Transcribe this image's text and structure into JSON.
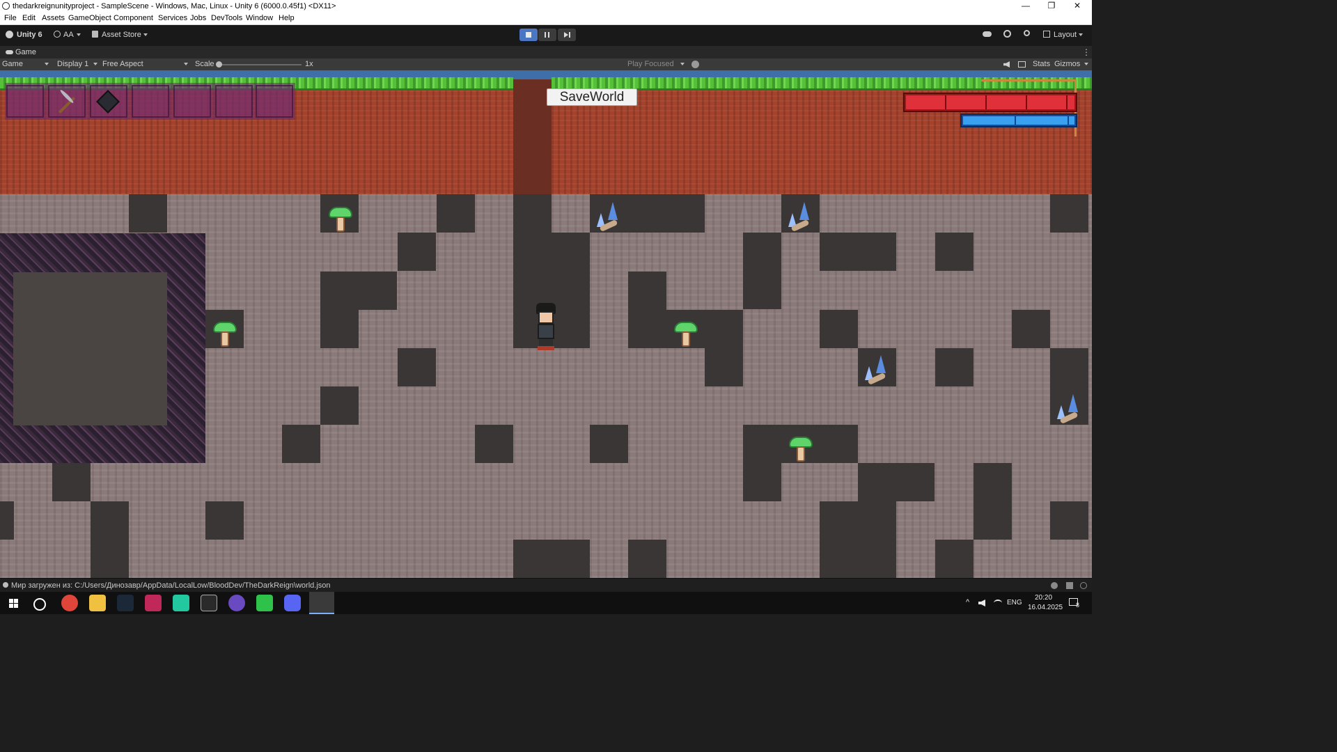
{
  "window": {
    "title": "thedarkreignunityproject - SampleScene - Windows, Mac, Linux - Unity 6 (6000.0.45f1) <DX11>",
    "controls": [
      "—",
      "❐",
      "✕"
    ]
  },
  "menubar": {
    "items": [
      "File",
      "Edit",
      "Assets",
      "GameObject",
      "Component",
      "Services",
      "Jobs",
      "DevTools",
      "Window",
      "Help"
    ]
  },
  "toolbar": {
    "unity_label": "Unity 6",
    "account_label": "AA",
    "asset_store_label": "Asset Store",
    "layout_label": "Layout"
  },
  "tab": {
    "game_label": "Game"
  },
  "game_toolbar": {
    "mode": "Game",
    "display": "Display 1",
    "aspect": "Free Aspect",
    "scale_label": "Scale",
    "scale_value": "1x",
    "scale_level": 0,
    "play_focused": "Play Focused",
    "stats_label": "Stats",
    "gizmos_label": "Gizmos"
  },
  "hud": {
    "save_button": "SaveWorld",
    "health_fraction": 1.0,
    "mana_fraction": 1.0,
    "hotbar_slots": [
      "empty",
      "pickaxe",
      "ore-bag",
      "empty",
      "empty",
      "empty",
      "empty"
    ]
  },
  "status": {
    "message": "Мир загружен из: C:/Users/Динозавр/AppData/LocalLow/BloodDev/TheDarkReign\\world.json"
  },
  "taskbar": {
    "language": "ENG",
    "time": "20:20",
    "date": "16.04.2025",
    "notifications": "8"
  },
  "colors": {
    "accent": "#4a76c4",
    "health": "#e0303a",
    "mana": "#3aa0f0"
  }
}
